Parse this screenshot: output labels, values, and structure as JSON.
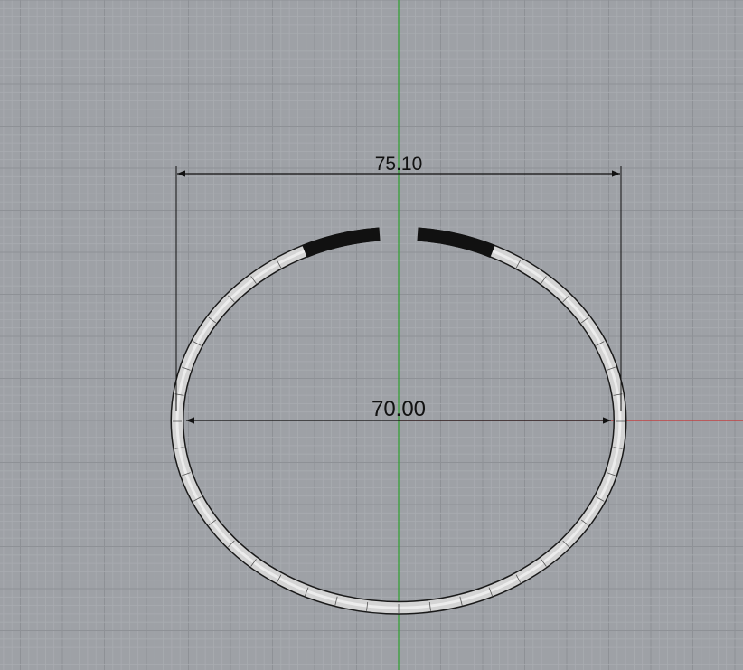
{
  "viewport": {
    "background": "#9ea1a6",
    "grid_minor_color": "#a9acb1",
    "grid_major_color": "#8e9196",
    "y_axis_color": "#2fa12f",
    "x_axis_color": "#c83232"
  },
  "dimensions": {
    "outer_width_label": "75.10",
    "inner_width_label": "70.00"
  },
  "bracelet": {
    "band_fill": "#d4d4d4",
    "band_outline": "#1a1a1a",
    "end_cap_color": "#111111"
  }
}
